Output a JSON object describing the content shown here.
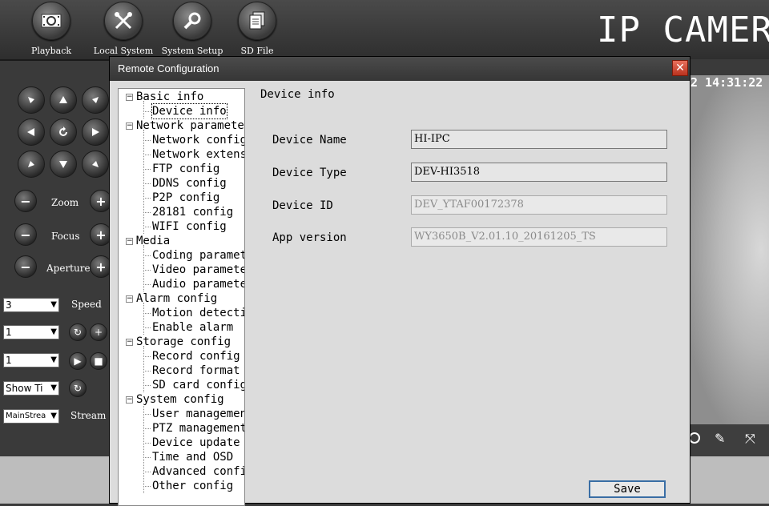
{
  "toolbar": {
    "buttons": [
      {
        "label": "Playback",
        "icon": "film-reel-icon"
      },
      {
        "label": "Local System",
        "icon": "tools-icon"
      },
      {
        "label": "System Setup",
        "icon": "wrench-gear-icon"
      },
      {
        "label": "SD File",
        "icon": "files-icon"
      }
    ],
    "brand": "IP CAMERA"
  },
  "left_panel": {
    "zoom_label": "Zoom",
    "focus_label": "Focus",
    "aperture_label": "Aperture",
    "speed_value": "3",
    "speed_label": "Speed",
    "preset_value": "1",
    "cruise_value": "1",
    "show_value": "Show Ti",
    "stream_value": "MainStrea",
    "stream_label": "Stream"
  },
  "video": {
    "timestamp": "2 14:31:22"
  },
  "dialog": {
    "title": "Remote Configuration",
    "close_label": "✕",
    "tree": [
      {
        "label": "Basic info",
        "children": [
          "Device info"
        ]
      },
      {
        "label": "Network paramete",
        "children": [
          "Network config",
          "Network extens",
          "FTP config",
          "DDNS config",
          "P2P config",
          "28181 config",
          "WIFI config"
        ]
      },
      {
        "label": "Media",
        "children": [
          "Coding paramet",
          "Video paramete",
          "Audio paramete"
        ]
      },
      {
        "label": "Alarm config",
        "children": [
          "Motion detecti",
          "Enable alarm"
        ]
      },
      {
        "label": "Storage config",
        "children": [
          "Record config",
          "Record format",
          "SD card config"
        ]
      },
      {
        "label": "System config",
        "children": [
          "User managemen",
          "PTZ management",
          "Device update",
          "Time and OSD",
          "Advanced confi",
          "Other config"
        ]
      }
    ],
    "section_title": "Device info",
    "fields": [
      {
        "label": "Device Name",
        "value": "HI-IPC"
      },
      {
        "label": "Device Type",
        "value": "DEV-HI3518"
      },
      {
        "label": "Device ID",
        "value": "DEV_YTAF00172378"
      },
      {
        "label": "App version",
        "value": "WY3650B_V2.01.10_20161205_TS"
      }
    ],
    "save_label": "Save"
  }
}
